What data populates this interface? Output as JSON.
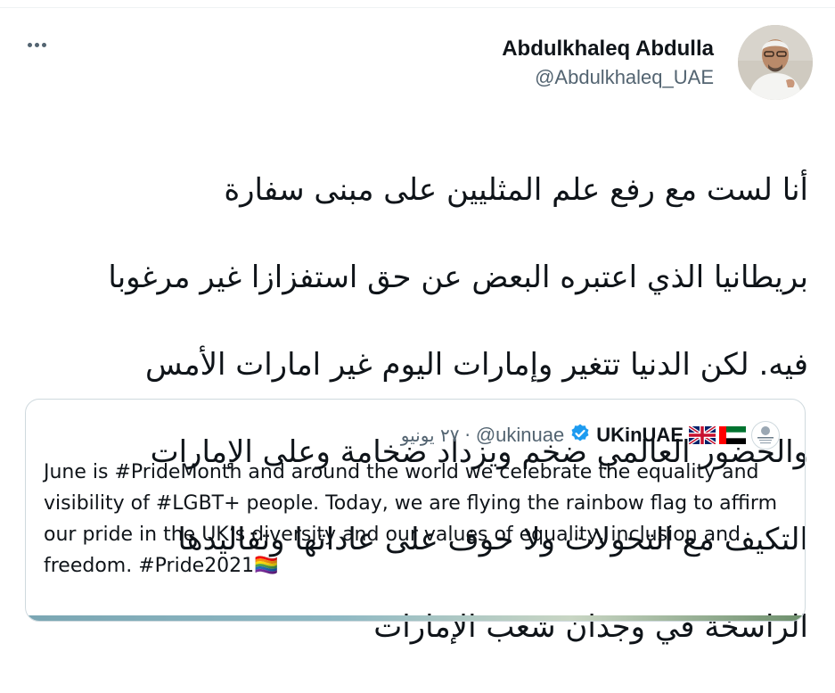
{
  "tweet": {
    "author_name": "Abdulkhaleq Abdulla",
    "author_handle": "@Abdulkhaleq_UAE",
    "text_lines": [
      "أنا لست مع رفع علم المثليين على مبنى سفارة",
      "بريطانيا الذي اعتبره البعض عن حق استفزازا غير مرغوبا",
      "فيه. لكن الدنيا تتغير وإمارات اليوم غير امارات الأمس",
      "والحضور العالمي ضخم ويزداد ضخامة وعلى الإمارات",
      "التكيف مع التحولات ولا خوف على عاداتها وتقاليدها",
      "الراسخة في وجدان شعب الإمارات"
    ],
    "more_icon": "more-horizontal-icon"
  },
  "quoted_tweet": {
    "author_name": "UKinUAE",
    "flags": "🇦🇪🇬🇧",
    "verified_icon": "verified-badge-icon",
    "author_handle": "@ukinuae",
    "separator": "·",
    "date": "٢٧ يونيو",
    "text": "June is #PrideMonth and around the world we celebrate the equality and visibility of #LGBT+ people. Today, we are flying the rainbow flag to affirm our pride in the UK’s diversity and our values of equality, inclusion and freedom. #Pride2021🏳️‍🌈"
  },
  "colors": {
    "text_primary": "#0f1419",
    "text_secondary": "#536471",
    "verified_blue": "#1d9bf0",
    "border": "#cfd9de"
  }
}
